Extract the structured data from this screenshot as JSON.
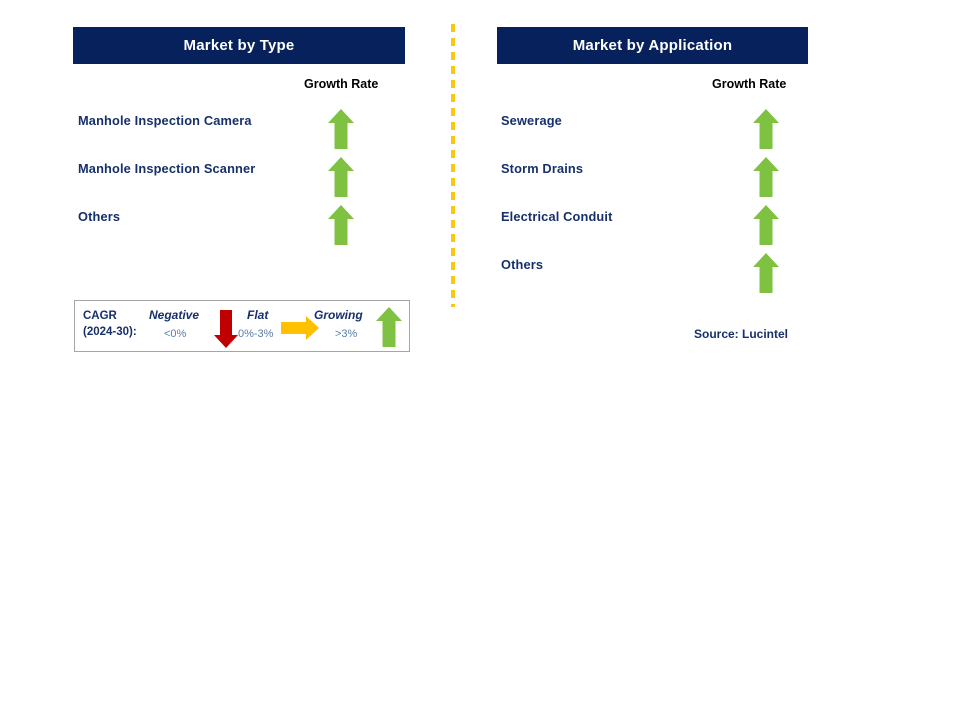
{
  "page": {
    "background": "#ffffff",
    "accent_navy": "#06215c",
    "label_navy": "#16306b",
    "green": "#7fc241",
    "red": "#c00000",
    "amber": "#ffc000",
    "divider_color": "#fcc512"
  },
  "panels": [
    {
      "id": "market-by-type",
      "title": "Market by Type",
      "column_header": "Growth Rate",
      "rows": [
        {
          "label": "Manhole Inspection Camera",
          "growth": "growing",
          "icon": "arrow-up-icon"
        },
        {
          "label": "Manhole Inspection Scanner",
          "growth": "growing",
          "icon": "arrow-up-icon"
        },
        {
          "label": "Others",
          "growth": "growing",
          "icon": "arrow-up-icon"
        }
      ]
    },
    {
      "id": "market-by-application",
      "title": "Market by Application",
      "column_header": "Growth Rate",
      "rows": [
        {
          "label": "Sewerage",
          "growth": "growing",
          "icon": "arrow-up-icon"
        },
        {
          "label": "Storm Drains",
          "growth": "growing",
          "icon": "arrow-up-icon"
        },
        {
          "label": "Electrical Conduit",
          "growth": "growing",
          "icon": "arrow-up-icon"
        },
        {
          "label": "Others",
          "growth": "growing",
          "icon": "arrow-up-icon"
        }
      ]
    }
  ],
  "legend": {
    "cagr_line1": "CAGR",
    "cagr_line2": "(2024-30):",
    "items": [
      {
        "title": "Negative",
        "value": "<0%",
        "icon": "arrow-down-icon",
        "color": "#c00000"
      },
      {
        "title": "Flat",
        "value": "0%-3%",
        "icon": "arrow-right-icon",
        "color": "#ffc000"
      },
      {
        "title": "Growing",
        "value": ">3%",
        "icon": "arrow-up-icon",
        "color": "#7fc241"
      }
    ]
  },
  "source": "Source: Lucintel"
}
